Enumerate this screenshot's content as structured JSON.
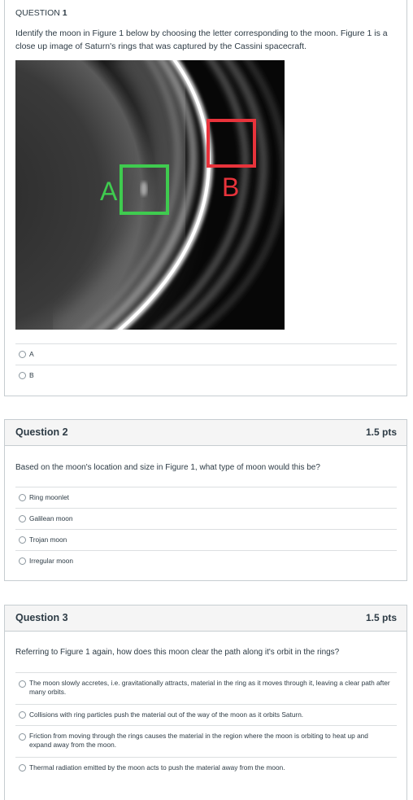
{
  "q1": {
    "title_prefix": "QUESTION ",
    "title_number": "1",
    "text": "Identify the moon in Figure 1 below by choosing the letter corresponding to the moon.  Figure 1 is a close up image of Saturn's rings that was captured by the Cassini spacecraft.",
    "figure": {
      "label_a": "A",
      "label_b": "B",
      "color_a": "#3fcb4f",
      "color_b": "#e8333b"
    },
    "answers": [
      "A",
      "B"
    ]
  },
  "q2": {
    "title": "Question 2",
    "points": "1.5 pts",
    "text": "Based on the moon's location and size in Figure 1, what type of moon would this be?",
    "answers": [
      "Ring moonlet",
      "Galilean moon",
      "Trojan moon",
      "Irregular moon"
    ]
  },
  "q3": {
    "title": "Question 3",
    "points": "1.5 pts",
    "text": "Referring to Figure 1 again, how does this moon clear the path along it's orbit in the rings?",
    "answers": [
      "The moon slowly accretes, i.e. gravitationally attracts, material in the ring as it moves through it, leaving a clear path after many orbits.",
      "Collisions with ring particles push the material out of the way of the moon as it orbits Saturn.",
      "Friction from moving through the rings causes the material in the region where the moon is orbiting to heat up and expand away from the moon.",
      "Thermal radiation emitted by the moon acts to push the material away from the moon."
    ]
  },
  "colors": {
    "border": "#c7cdd1",
    "header_bg": "#f5f5f5",
    "text": "#2d3b45",
    "divider": "#dcdfe1"
  }
}
